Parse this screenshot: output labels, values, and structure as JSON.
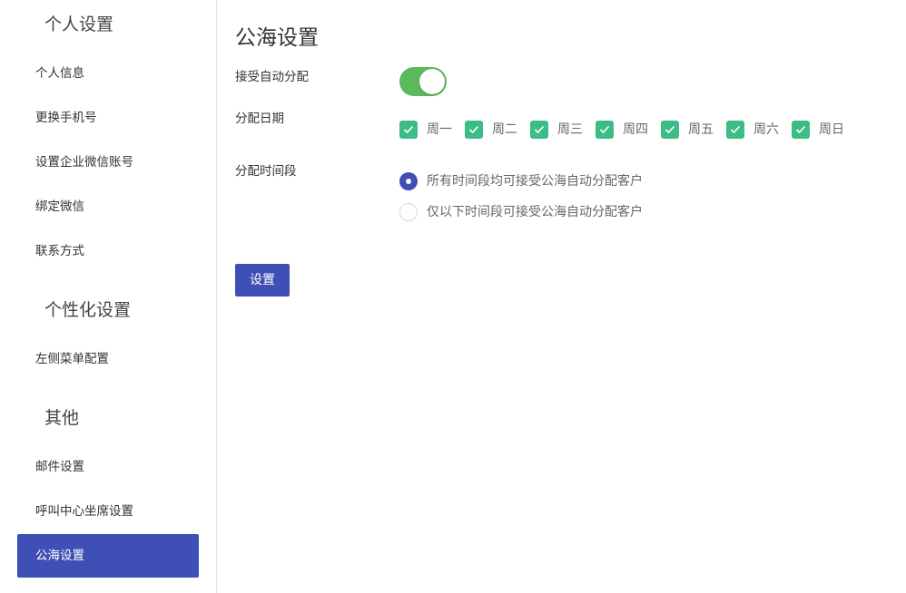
{
  "sidebar": {
    "groups": [
      {
        "title": "个人设置",
        "items": [
          "个人信息",
          "更换手机号",
          "设置企业微信账号",
          "绑定微信",
          "联系方式"
        ]
      },
      {
        "title": "个性化设置",
        "items": [
          "左侧菜单配置"
        ]
      },
      {
        "title": "其他",
        "items": [
          "邮件设置",
          "呼叫中心坐席设置",
          "公海设置"
        ]
      }
    ],
    "active_item": "公海设置"
  },
  "page": {
    "title": "公海设置",
    "auto_assign": {
      "label": "接受自动分配",
      "enabled": true
    },
    "assign_days": {
      "label": "分配日期",
      "days": [
        {
          "label": "周一",
          "checked": true
        },
        {
          "label": "周二",
          "checked": true
        },
        {
          "label": "周三",
          "checked": true
        },
        {
          "label": "周四",
          "checked": true
        },
        {
          "label": "周五",
          "checked": true
        },
        {
          "label": "周六",
          "checked": true
        },
        {
          "label": "周日",
          "checked": true
        }
      ]
    },
    "assign_time": {
      "label": "分配时间段",
      "options": [
        {
          "label": "所有时间段均可接受公海自动分配客户",
          "selected": true
        },
        {
          "label": "仅以下时间段可接受公海自动分配客户",
          "selected": false
        }
      ]
    },
    "submit_label": "设置"
  },
  "colors": {
    "primary": "#3f4fb5",
    "toggle_on": "#5cb85c",
    "checkbox": "#3dbd86",
    "divider": "#e6e6e6"
  }
}
